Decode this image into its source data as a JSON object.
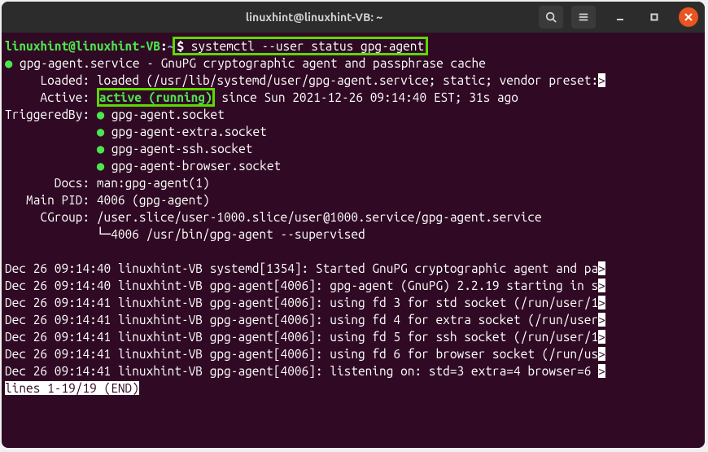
{
  "titlebar": {
    "title": "linuxhint@linuxhint-VB: ~"
  },
  "prompt": {
    "user_host": "linuxhint@linuxhint-VB",
    "colon": ":",
    "path": "~",
    "symbol": "$ ",
    "command": "systemctl --user status gpg-agent"
  },
  "status": {
    "dot": "●",
    "service_line": " gpg-agent.service - GnuPG cryptographic agent and passphrase cache",
    "loaded_label": "     Loaded: ",
    "loaded_value": "loaded (/usr/lib/systemd/user/gpg-agent.service; static; vendor preset:",
    "loaded_arrow": ">",
    "active_label": "     Active: ",
    "active_state": "active (running)",
    "active_rest": " since Sun 2021-12-26 09:14:40 EST; 31s ago",
    "triggered_label": "TriggeredBy: ",
    "triggers": [
      "gpg-agent.socket",
      "gpg-agent-extra.socket",
      "gpg-agent-ssh.socket",
      "gpg-agent-browser.socket"
    ],
    "docs_label": "       Docs: ",
    "docs_value": "man:gpg-agent(1)",
    "main_pid_label": "   Main PID: ",
    "main_pid_value": "4006 (gpg-agent)",
    "cgroup_label": "     CGroup: ",
    "cgroup_value": "/user.slice/user-1000.slice/user@1000.service/gpg-agent.service",
    "cgroup_tree": "             └─4006 /usr/bin/gpg-agent --supervised"
  },
  "logs": [
    {
      "text": "Dec 26 09:14:40 linuxhint-VB systemd[1354]: Started GnuPG cryptographic agent and pa",
      "arrow": ">"
    },
    {
      "text": "Dec 26 09:14:40 linuxhint-VB gpg-agent[4006]: gpg-agent (GnuPG) 2.2.19 starting in s",
      "arrow": ">"
    },
    {
      "text": "Dec 26 09:14:41 linuxhint-VB gpg-agent[4006]: using fd 3 for std socket (/run/user/1",
      "arrow": ">"
    },
    {
      "text": "Dec 26 09:14:41 linuxhint-VB gpg-agent[4006]: using fd 4 for extra socket (/run/user",
      "arrow": ">"
    },
    {
      "text": "Dec 26 09:14:41 linuxhint-VB gpg-agent[4006]: using fd 5 for ssh socket (/run/user/1",
      "arrow": ">"
    },
    {
      "text": "Dec 26 09:14:41 linuxhint-VB gpg-agent[4006]: using fd 6 for browser socket (/run/us",
      "arrow": ">"
    },
    {
      "text": "Dec 26 09:14:41 linuxhint-VB gpg-agent[4006]: listening on: std=3 extra=4 browser=6 ",
      "arrow": ">"
    }
  ],
  "pager": {
    "status": "lines 1-19/19 (END)"
  }
}
